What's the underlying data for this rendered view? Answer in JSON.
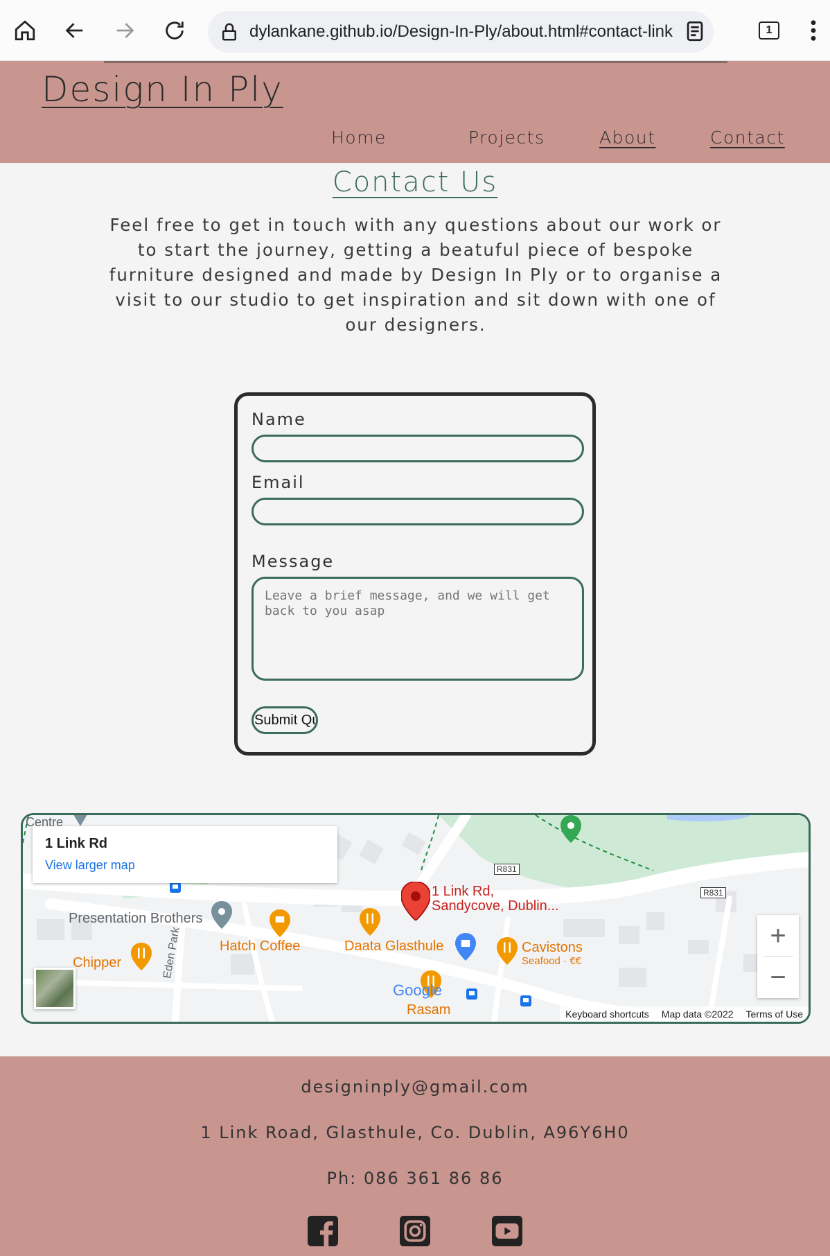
{
  "browser": {
    "url": "dylankane.github.io/Design-In-Ply/about.html#contact-link",
    "tab_count": "1"
  },
  "site": {
    "logo": "Design In Ply",
    "nav": {
      "home": "Home",
      "projects": "Projects",
      "about": "About",
      "contact": "Contact"
    }
  },
  "contact": {
    "title": "Contact Us",
    "intro": "Feel free to get in touch with any questions about our work or to start the journey, getting a beatuful piece of bespoke furniture designed and made by Design In Ply or to organise a visit to our studio to get inspiration and sit down with one of our designers."
  },
  "form": {
    "name_label": "Name",
    "email_label": "Email",
    "message_label": "Message",
    "message_placeholder": "Leave a brief message, and we will get back to you asap",
    "submit_label": "Submit Query"
  },
  "map": {
    "place_name": "1 Link Rd",
    "view_larger": "View larger map",
    "pin_label_line1": "1 Link Rd,",
    "pin_label_line2": "Sandycove, Dublin...",
    "pois": {
      "centre": "Centre",
      "presentation": "Presentation Brothers",
      "hatch": "Hatch Coffee",
      "daata": "Daata Glasthule",
      "cavistons": "Cavistons",
      "cavistons_sub": "Seafood · €€",
      "chipper": "Chipper",
      "rasam": "Rasam",
      "eden": "Eden Park",
      "r831a": "R831",
      "r831b": "R831",
      "google": "Google"
    },
    "zoom_in": "+",
    "zoom_out": "−",
    "attrib_keys": "Keyboard shortcuts",
    "attrib_data": "Map data ©2022",
    "attrib_terms": "Terms of Use"
  },
  "footer": {
    "email": "designinply@gmail.com",
    "address": "1 Link Road, Glasthule, Co. Dublin, A96Y6H0",
    "phone": "Ph: 086 361 86 86"
  },
  "colors": {
    "header_bg": "#c8958f",
    "accent_green": "#3b6b5b",
    "page_bg": "#f4f4f4"
  }
}
